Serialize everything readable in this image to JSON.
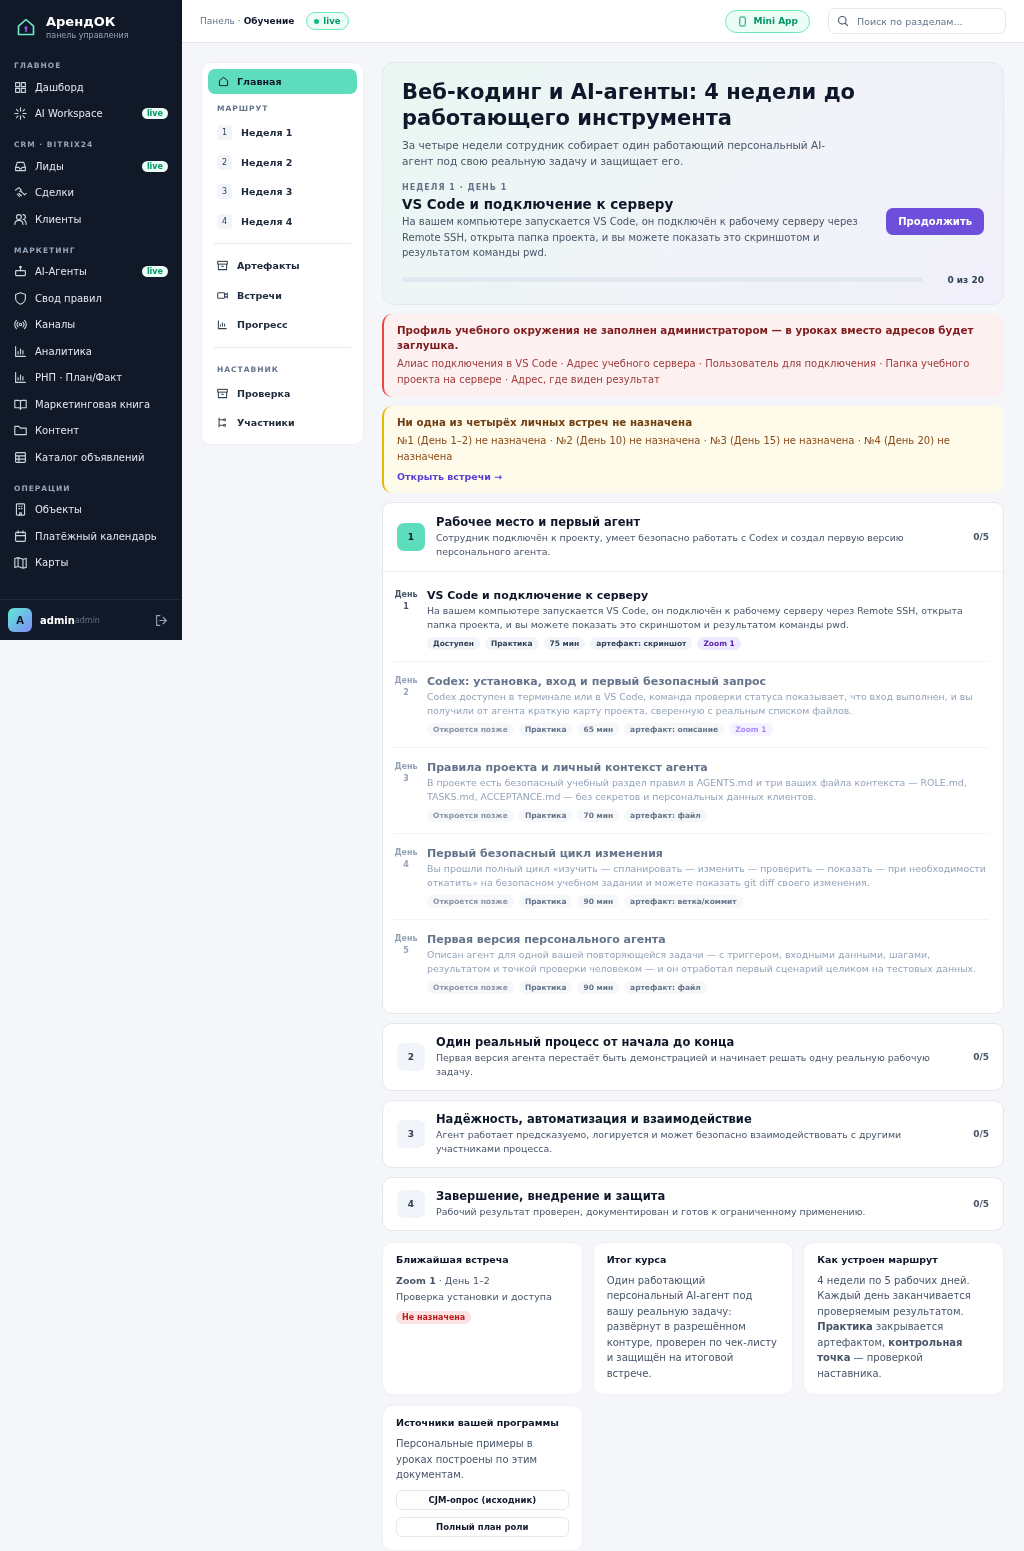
{
  "brand": {
    "name": "АрендОК",
    "subtitle": "панель управления"
  },
  "sidebar": {
    "sections": [
      {
        "title": "ГЛАВНОЕ",
        "items": [
          {
            "label": "Дашборд"
          },
          {
            "label": "AI Workspace",
            "badge": "live"
          }
        ]
      },
      {
        "title": "CRM · BITRIX24",
        "items": [
          {
            "label": "Лиды",
            "badge": "live"
          },
          {
            "label": "Сделки"
          },
          {
            "label": "Клиенты"
          }
        ]
      },
      {
        "title": "МАРКЕТИНГ",
        "items": [
          {
            "label": "AI-Агенты",
            "badge": "live"
          },
          {
            "label": "Свод правил"
          },
          {
            "label": "Каналы"
          },
          {
            "label": "Аналитика"
          },
          {
            "label": "РНП · План/Факт"
          },
          {
            "label": "Маркетинговая книга"
          },
          {
            "label": "Контент"
          },
          {
            "label": "Каталог объявлений"
          }
        ]
      },
      {
        "title": "ОПЕРАЦИИ",
        "items": [
          {
            "label": "Объекты"
          },
          {
            "label": "Платёжный календарь"
          },
          {
            "label": "Карты"
          }
        ]
      }
    ],
    "user": {
      "avatar": "A",
      "name": "admin",
      "role": "admin"
    }
  },
  "topbar": {
    "breadcrumb": {
      "parent": "Панель",
      "separator": "·",
      "current": "Обучение"
    },
    "status": "live",
    "mini_app": "Mini App",
    "search": {
      "placeholder": "Поиск по разделам..."
    }
  },
  "course_nav": {
    "home": {
      "label": "Главная",
      "selected": true
    },
    "route_title": "МАРШРУТ",
    "weeks": [
      {
        "num": "1",
        "label": "Неделя 1",
        "selected": false
      },
      {
        "num": "2",
        "label": "Неделя 2",
        "selected": false
      },
      {
        "num": "3",
        "label": "Неделя 3",
        "selected": false
      },
      {
        "num": "4",
        "label": "Неделя 4",
        "selected": false
      }
    ],
    "links": [
      {
        "label": "Артефакты",
        "selected": false
      },
      {
        "label": "Встречи",
        "selected": false
      },
      {
        "label": "Прогресс",
        "selected": false
      }
    ],
    "mentor_title": "НАСТАВНИК",
    "mentor_links": [
      {
        "label": "Проверка",
        "selected": false
      },
      {
        "label": "Участники",
        "selected": false
      }
    ]
  },
  "hero": {
    "title": "Веб-кодинг и AI-агенты: 4 недели до работающего инструмента",
    "lead": "За четыре недели сотрудник собирает один работающий персональный AI-агент под свою реальную задачу и защищает его.",
    "current_label": "НЕДЕЛЯ 1 · ДЕНЬ 1",
    "current_title": "VS Code и подключение к серверу",
    "current_desc": "На вашем компьютере запускается VS Code, он подключён к рабочему серверу через Remote SSH, открыта папка проекта, и вы можете показать это скриншотом и результатом команды pwd.",
    "button": "Продолжить",
    "level": 0,
    "progress": "0 из 20"
  },
  "alerts": [
    {
      "kind": "error",
      "title": "Профиль учебного окружения не заполнен администратором — в уроках вместо адресов будет заглушка.",
      "text": "Алиас подключения в VS Code · Адрес учебного сервера · Пользователь для подключения · Папка учебного проекта на сервере · Адрес, где виден результат"
    },
    {
      "kind": "warning",
      "title": "Ни одна из четырёх личных встреч не назначена",
      "text": "№1 (День 1–2) не назначена · №2 (День 10) не назначена · №3 (День 15) не назначена · №4 (День 20) не назначена",
      "link": "Открыть встречи →"
    }
  ],
  "weeks": [
    {
      "num": "1",
      "title": "Рабочее место и первый агент",
      "desc": "Сотрудник подключён к проекту, умеет безопасно работать с Codex и создал первую версию персонального агента.",
      "progress": "0/5",
      "expanded": true,
      "days": [
        {
          "day_label": "День",
          "day": "1",
          "title": "VS Code и подключение к серверу",
          "desc": "На вашем компьютере запускается VS Code, он подключён к рабочему серверу через Remote SSH, открыта папка проекта, и вы можете показать это скриншотом и результатом команды pwd.",
          "locked": false,
          "tags": [
            {
              "text": "Доступен",
              "kind": "status"
            },
            {
              "text": "Практика",
              "kind": "plain"
            },
            {
              "text": "75 мин",
              "kind": "plain"
            },
            {
              "text": "артефакт: скриншот",
              "kind": "plain"
            },
            {
              "text": "Zoom 1",
              "kind": "zoom"
            }
          ]
        },
        {
          "day_label": "День",
          "day": "2",
          "title": "Codex: установка, вход и первый безопасный запрос",
          "desc": "Codex доступен в терминале или в VS Code, команда проверки статуса показывает, что вход выполнен, и вы получили от агента краткую карту проекта, сверенную с реальным списком файлов.",
          "locked": true,
          "tags": [
            {
              "text": "Откроется позже",
              "kind": "status"
            },
            {
              "text": "Практика",
              "kind": "plain"
            },
            {
              "text": "65 мин",
              "kind": "plain"
            },
            {
              "text": "артефакт: описание",
              "kind": "plain"
            },
            {
              "text": "Zoom 1",
              "kind": "zoom"
            }
          ]
        },
        {
          "day_label": "День",
          "day": "3",
          "title": "Правила проекта и личный контекст агента",
          "desc": "В проекте есть безопасный учебный раздел правил в AGENTS.md и три ваших файла контекста — ROLE.md, TASKS.md, ACCEPTANCE.md — без секретов и персональных данных клиентов.",
          "locked": true,
          "tags": [
            {
              "text": "Откроется позже",
              "kind": "status"
            },
            {
              "text": "Практика",
              "kind": "plain"
            },
            {
              "text": "70 мин",
              "kind": "plain"
            },
            {
              "text": "артефакт: файл",
              "kind": "plain"
            }
          ]
        },
        {
          "day_label": "День",
          "day": "4",
          "title": "Первый безопасный цикл изменения",
          "desc": "Вы прошли полный цикл «изучить — спланировать — изменить — проверить — показать — при необходимости откатить» на безопасном учебном задании и можете показать git diff своего изменения.",
          "locked": true,
          "tags": [
            {
              "text": "Откроется позже",
              "kind": "status"
            },
            {
              "text": "Практика",
              "kind": "plain"
            },
            {
              "text": "90 мин",
              "kind": "plain"
            },
            {
              "text": "артефакт: ветка/коммит",
              "kind": "plain"
            }
          ]
        },
        {
          "day_label": "День",
          "day": "5",
          "title": "Первая версия персонального агента",
          "desc": "Описан агент для одной вашей повторяющейся задачи — с триггером, входными данными, шагами, результатом и точкой проверки человеком — и он отработал первый сценарий целиком на тестовых данных.",
          "locked": true,
          "tags": [
            {
              "text": "Откроется позже",
              "kind": "status"
            },
            {
              "text": "Практика",
              "kind": "plain"
            },
            {
              "text": "90 мин",
              "kind": "plain"
            },
            {
              "text": "артефакт: файл",
              "kind": "plain"
            }
          ]
        }
      ]
    },
    {
      "num": "2",
      "title": "Один реальный процесс от начала до конца",
      "desc": "Первая версия агента перестаёт быть демонстрацией и начинает решать одну реальную рабочую задачу.",
      "progress": "0/5",
      "expanded": false
    },
    {
      "num": "3",
      "title": "Надёжность, автоматизация и взаимодействие",
      "desc": "Агент работает предсказуемо, логируется и может безопасно взаимодействовать с другими участниками процесса.",
      "progress": "0/5",
      "expanded": false
    },
    {
      "num": "4",
      "title": "Завершение, внедрение и защита",
      "desc": "Рабочий результат проверен, документирован и готов к ограниченному применению.",
      "progress": "0/5",
      "expanded": false
    }
  ],
  "info_cards": [
    {
      "kind": "meeting",
      "title": "Ближайшая встреча",
      "lines": [
        "**Zoom 1** · День 1–2",
        "Проверка установки и доступа"
      ],
      "badge": "Не назначена"
    },
    {
      "kind": "text",
      "title": "Итог курса",
      "lines": [
        "Один работающий персональный AI-агент под вашу реальную задачу: развёрнут в разрешённом контуре, проверен по чек-листу и защищён на итоговой встрече."
      ]
    },
    {
      "kind": "text",
      "title": "Как устроен маршрут",
      "lines": [
        "4 недели по 5 рабочих дней. Каждый день заканчивается проверяемым результатом. **Практика** закрывается артефактом, **контрольная точка** — проверкой наставника."
      ]
    },
    {
      "kind": "sources",
      "title": "Источники вашей программы",
      "lines": [
        "Персональные примеры в уроках построены по этим документам."
      ],
      "buttons": [
        "CJM-опрос (исходник)",
        "Полный план роли"
      ]
    }
  ]
}
